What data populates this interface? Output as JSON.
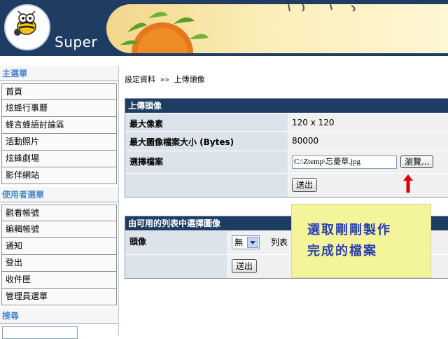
{
  "header": {
    "logo_text": "Super"
  },
  "sidebar": {
    "main_menu_title": "主選單",
    "main_menu": [
      "首頁",
      "炫蜂行事曆",
      "蜂言蜂語討論區",
      "活動照片",
      "炫蜂劇場",
      "影伴網站"
    ],
    "user_menu_title": "使用者選單",
    "user_menu": [
      "觀看帳號",
      "編輯帳號",
      "通知",
      "登出",
      "收件匣",
      "管理員選單"
    ],
    "search_title": "搜尋"
  },
  "breadcrumb": {
    "parent": "設定資料",
    "separator": "»»",
    "current": "上傳頭像"
  },
  "upload_panel": {
    "title": "上傳頭像",
    "max_pixels_label": "最大像素",
    "max_pixels_value": "120 x 120",
    "max_size_label": "最大圖像檔案大小 (Bytes)",
    "max_size_value": "80000",
    "choose_file_label": "選擇檔案",
    "file_path": "C:\\Ztemp\\忘憂草.jpg",
    "browse_label": "瀏覽...",
    "submit_label": "送出"
  },
  "select_panel": {
    "title": "由可用的列表中選擇圖像",
    "avatar_label": "頭像",
    "select_value": "無",
    "list_label": "列表",
    "submit_label": "送出"
  },
  "callout": {
    "line1": "選取剛剛製作",
    "line2": "完成的檔案",
    "arrow_color": "#e00000"
  }
}
